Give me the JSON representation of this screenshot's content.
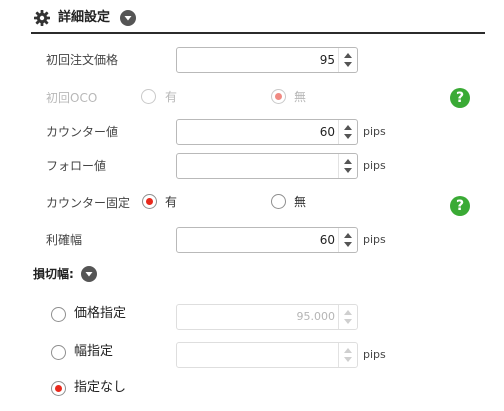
{
  "header": {
    "title": "詳細設定",
    "gear_icon": "gear-icon",
    "toggle_icon": "chevron-down-icon"
  },
  "rows": {
    "initial_price": {
      "label": "初回注文価格",
      "value": "95"
    },
    "initial_oco": {
      "label": "初回OCO",
      "opt_yes": "有",
      "opt_no": "無",
      "selected": "無",
      "disabled": true
    },
    "counter_value": {
      "label": "カウンター値",
      "value": "60",
      "unit": "pips"
    },
    "follow_value": {
      "label": "フォロー値",
      "value": "",
      "unit": "pips"
    },
    "counter_fixed": {
      "label": "カウンター固定",
      "opt_yes": "有",
      "opt_no": "無",
      "selected": "有"
    },
    "take_profit": {
      "label": "利確幅",
      "value": "60",
      "unit": "pips"
    }
  },
  "stop_loss": {
    "title": "損切幅:",
    "options": [
      {
        "label": "価格指定",
        "value": "95.000",
        "selected": false
      },
      {
        "label": "幅指定",
        "value": "",
        "unit": "pips",
        "selected": false
      },
      {
        "label": "指定なし",
        "selected": true
      }
    ]
  },
  "help_label": "?",
  "colors": {
    "accent_red": "#e8291c",
    "help_green": "#3aaa35",
    "header_line": "#2b2b2b"
  }
}
